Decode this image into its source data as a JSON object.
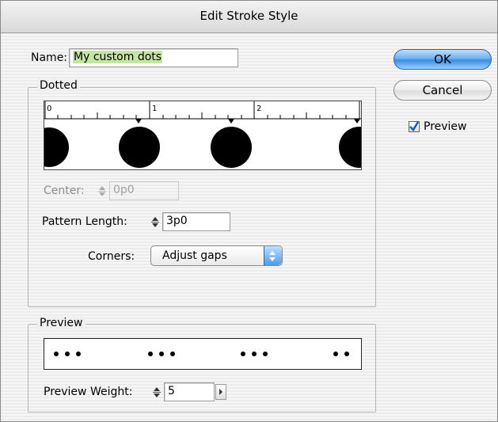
{
  "window": {
    "title": "Edit Stroke Style"
  },
  "name_field": {
    "label": "Name:",
    "value": "My custom dots"
  },
  "buttons": {
    "ok": "OK",
    "cancel": "Cancel"
  },
  "preview_checkbox": {
    "label": "Preview",
    "checked": true
  },
  "dotted_group": {
    "title": "Dotted",
    "ruler_labels": [
      "0",
      "1",
      "2"
    ],
    "center": {
      "label": "Center:",
      "value": "0p0"
    },
    "pattern_length": {
      "label": "Pattern Length:",
      "value": "3p0"
    },
    "corners": {
      "label": "Corners:",
      "value": "Adjust gaps"
    }
  },
  "preview_group": {
    "title": "Preview",
    "weight": {
      "label": "Preview Weight:",
      "value": "5"
    }
  },
  "colors": {
    "name_highlight": "#c4e6a0",
    "ok_button": "#4f9ae6"
  }
}
